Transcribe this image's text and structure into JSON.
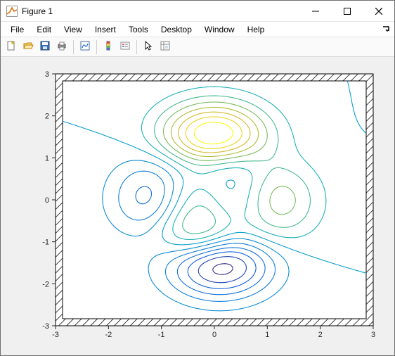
{
  "window": {
    "title": "Figure 1"
  },
  "menu": {
    "items": [
      "File",
      "Edit",
      "View",
      "Insert",
      "Tools",
      "Desktop",
      "Window",
      "Help"
    ]
  },
  "toolbar": {
    "buttons": [
      {
        "name": "new-figure-button",
        "icon": "new-icon"
      },
      {
        "name": "open-button",
        "icon": "open-icon"
      },
      {
        "name": "save-button",
        "icon": "save-icon"
      },
      {
        "name": "print-button",
        "icon": "print-icon"
      },
      {
        "sep": true
      },
      {
        "name": "link-plot-button",
        "icon": "link-icon"
      },
      {
        "sep": true
      },
      {
        "name": "insert-colorbar-button",
        "icon": "colorbar-icon"
      },
      {
        "name": "insert-legend-button",
        "icon": "legend-icon"
      },
      {
        "sep": true
      },
      {
        "name": "edit-plot-button",
        "icon": "pointer-icon"
      },
      {
        "name": "open-property-editor-button",
        "icon": "property-icon"
      }
    ]
  },
  "chart_data": {
    "type": "contour",
    "function": "peaks",
    "xlim": [
      -3,
      3
    ],
    "ylim": [
      -3,
      3
    ],
    "xticks": [
      -3,
      -2,
      -1,
      0,
      1,
      2,
      3
    ],
    "yticks": [
      -3,
      -2,
      -1,
      0,
      1,
      2,
      3
    ],
    "levels": [
      -6,
      -5,
      -4,
      -3,
      -2,
      -1,
      0,
      1,
      2,
      3,
      4,
      5,
      6,
      7
    ],
    "colormap": "parula",
    "grid": false,
    "title": "",
    "xlabel": "",
    "ylabel": "",
    "peaks_terms": [
      {
        "a": 3,
        "cx": 0,
        "cy": -1,
        "sx": 1,
        "sy": 1,
        "poly": [
          [
            0,
            0,
            1
          ],
          [
            1,
            0,
            -1
          ]
        ]
      },
      {
        "a": -10,
        "cx": 0,
        "cy": 0,
        "sx": 1,
        "sy": 1,
        "poly": [
          [
            1,
            0,
            0.2
          ],
          [
            3,
            0,
            -1
          ],
          [
            0,
            5,
            -1
          ]
        ]
      },
      {
        "a": -0.333333,
        "cx": 1,
        "cy": 1,
        "sx": 1,
        "sy": 1,
        "poly": [
          [
            0,
            0,
            1
          ]
        ]
      }
    ]
  },
  "axes": {
    "box_style": "hatched",
    "bg": "#ffffff"
  }
}
